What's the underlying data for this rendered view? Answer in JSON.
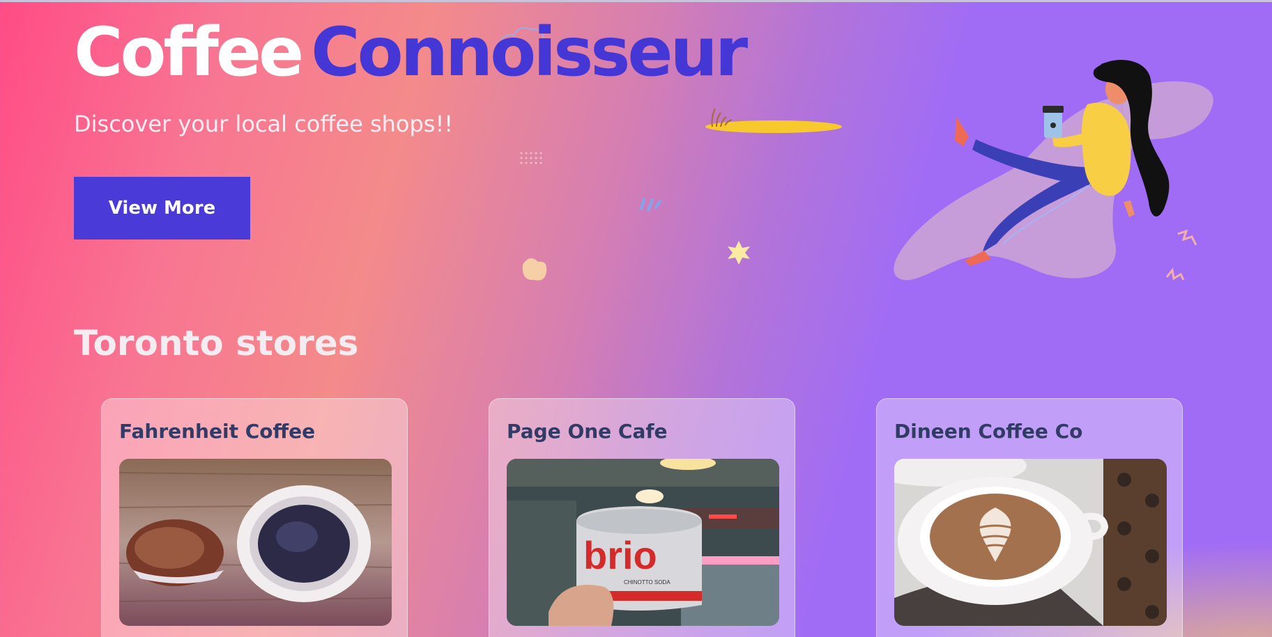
{
  "hero": {
    "title_word1": "Coffee",
    "title_word2": "Connoisseur",
    "subtitle": "Discover your local coffee shops!!",
    "button_label": "View More",
    "illustration": "woman-drinking-coffee-illustration"
  },
  "section": {
    "title": "Toronto stores"
  },
  "stores": [
    {
      "name": "Fahrenheit Coffee",
      "image": "muffin-and-espresso-photo"
    },
    {
      "name": "Page One Cafe",
      "image": "soda-can-cafe-photo"
    },
    {
      "name": "Dineen Coffee Co",
      "image": "latte-art-photo"
    }
  ],
  "photo_texts": {
    "can_brand": "brio",
    "can_subtext": "CHINOTTO SODA"
  },
  "colors": {
    "accent": "#4a3ad8",
    "title_accent": "#4437d6",
    "card_title": "#323a66",
    "gradient_start": "#ff4c86",
    "gradient_end": "#a06cf6"
  }
}
